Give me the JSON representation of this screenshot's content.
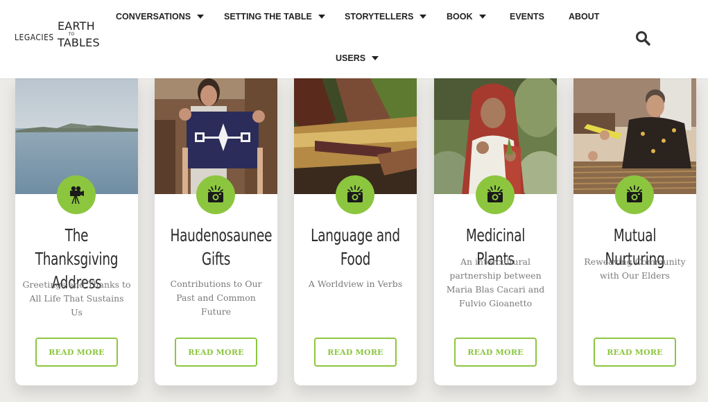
{
  "header": {
    "logo": {
      "left": "LEGACIES",
      "earth": "EARTH",
      "to": "TO",
      "tables": "TABLES"
    },
    "nav": [
      {
        "label": "CONVERSATIONS",
        "has_dropdown": true
      },
      {
        "label": "SETTING THE TABLE",
        "has_dropdown": true
      },
      {
        "label": "STORYTELLERS",
        "has_dropdown": true
      },
      {
        "label": "BOOK",
        "has_dropdown": true
      },
      {
        "label": "EVENTS",
        "has_dropdown": false
      },
      {
        "label": "ABOUT",
        "has_dropdown": false
      },
      {
        "label": "USERS",
        "has_dropdown": true
      }
    ],
    "search_icon": "search-icon"
  },
  "cards": [
    {
      "title": "The Thanksgiving Address",
      "description": "Greetings and Thanks to All Life That Sustains Us",
      "icon": "film-camera-icon",
      "button": "READ MORE"
    },
    {
      "title": "Haudenosaunee Gifts",
      "description": "Contributions to Our Past and Common Future",
      "icon": "photo-camera-icon",
      "button": "READ MORE"
    },
    {
      "title": "Language and Food",
      "description": "A Worldview in Verbs",
      "icon": "photo-camera-icon",
      "button": "READ MORE"
    },
    {
      "title": "Medicinal Plants",
      "description": "An intercultural partnership between Maria Blas Cacari and Fulvio Gioanetto",
      "icon": "photo-camera-icon",
      "button": "READ MORE"
    },
    {
      "title": "Mutual Nurturing",
      "description": "Reweaving Community with Our Elders",
      "icon": "photo-camera-icon",
      "button": "READ MORE"
    }
  ],
  "colors": {
    "accent": "#8cc63f",
    "text_dark": "#2b2b2b",
    "text_muted": "#7a7a7a"
  }
}
